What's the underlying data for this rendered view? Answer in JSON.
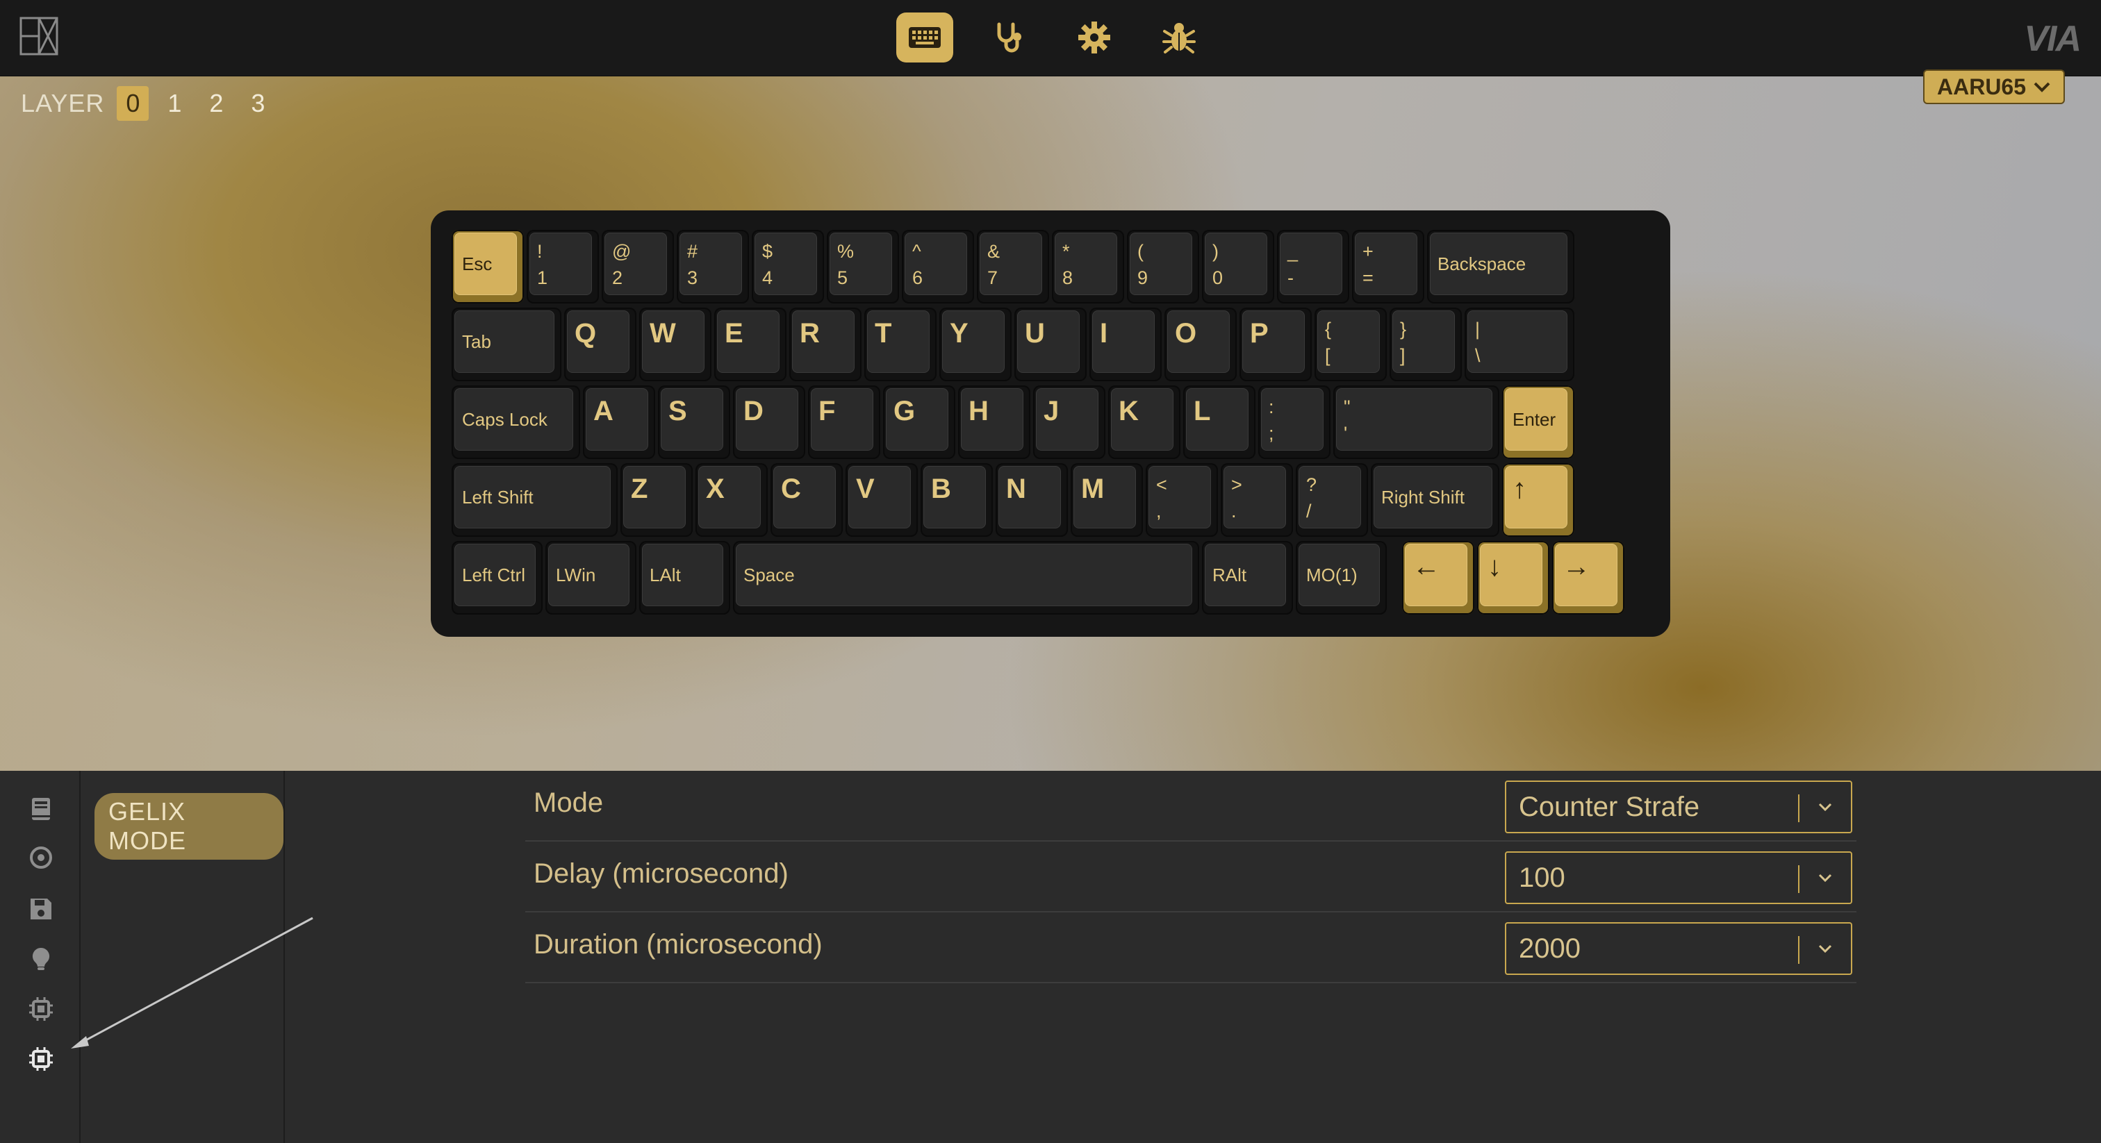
{
  "nav": {
    "items": [
      {
        "name": "keyboard-icon",
        "active": true
      },
      {
        "name": "stethoscope-icon",
        "active": false
      },
      {
        "name": "gear-icon",
        "active": false
      },
      {
        "name": "bug-icon",
        "active": false
      }
    ],
    "brand": "VIA"
  },
  "layers": {
    "label": "LAYER",
    "items": [
      "0",
      "1",
      "2",
      "3"
    ],
    "active": "0"
  },
  "device": {
    "name": "AARU65"
  },
  "keyboard": {
    "rows": [
      [
        {
          "top": "Esc",
          "gold": true
        },
        {
          "top": "!",
          "bottom": "1"
        },
        {
          "top": "@",
          "bottom": "2"
        },
        {
          "top": "#",
          "bottom": "3"
        },
        {
          "top": "$",
          "bottom": "4"
        },
        {
          "top": "%",
          "bottom": "5"
        },
        {
          "top": "^",
          "bottom": "6"
        },
        {
          "top": "&",
          "bottom": "7"
        },
        {
          "top": "*",
          "bottom": "8"
        },
        {
          "top": "(",
          "bottom": "9"
        },
        {
          "top": ")",
          "bottom": "0"
        },
        {
          "top": "_",
          "bottom": "-"
        },
        {
          "top": "+",
          "bottom": "="
        },
        {
          "top": "Backspace"
        }
      ],
      [
        {
          "top": "Tab"
        },
        {
          "top": "Q"
        },
        {
          "top": "W"
        },
        {
          "top": "E"
        },
        {
          "top": "R"
        },
        {
          "top": "T"
        },
        {
          "top": "Y"
        },
        {
          "top": "U"
        },
        {
          "top": "I"
        },
        {
          "top": "O"
        },
        {
          "top": "P"
        },
        {
          "top": "{",
          "bottom": "["
        },
        {
          "top": "}",
          "bottom": "]"
        },
        {
          "top": "|",
          "bottom": "\\"
        }
      ],
      [
        {
          "top": "Caps Lock"
        },
        {
          "top": "A"
        },
        {
          "top": "S"
        },
        {
          "top": "D"
        },
        {
          "top": "F"
        },
        {
          "top": "G"
        },
        {
          "top": "H"
        },
        {
          "top": "J"
        },
        {
          "top": "K"
        },
        {
          "top": "L"
        },
        {
          "top": ":",
          "bottom": ";"
        },
        {
          "top": "\"",
          "bottom": "'"
        },
        {
          "top": "Enter",
          "gold": true
        }
      ],
      [
        {
          "top": "Left Shift"
        },
        {
          "top": "Z"
        },
        {
          "top": "X"
        },
        {
          "top": "C"
        },
        {
          "top": "V"
        },
        {
          "top": "B"
        },
        {
          "top": "N"
        },
        {
          "top": "M"
        },
        {
          "top": "<",
          "bottom": ","
        },
        {
          "top": ">",
          "bottom": "."
        },
        {
          "top": "?",
          "bottom": "/"
        },
        {
          "top": "Right Shift"
        },
        {
          "top": "↑",
          "gold": true
        }
      ],
      [
        {
          "top": "Left Ctrl"
        },
        {
          "top": "LWin"
        },
        {
          "top": "LAlt"
        },
        {
          "top": "Space"
        },
        {
          "top": "RAlt"
        },
        {
          "top": "MO(1)"
        },
        {
          "top": "←",
          "gold": true
        },
        {
          "top": "↓",
          "gold": true
        },
        {
          "top": "→",
          "gold": true
        }
      ]
    ]
  },
  "sidebar": {
    "icons": [
      "book-icon",
      "target-icon",
      "save-icon",
      "lightbulb-icon",
      "chip-icon",
      "chip-icon"
    ]
  },
  "menu": {
    "items": [
      "GELIX MODE"
    ]
  },
  "settings": {
    "rows": [
      {
        "label": "Mode",
        "value": "Counter Strafe"
      },
      {
        "label": "Delay (microsecond)",
        "value": "100"
      },
      {
        "label": "Duration (microsecond)",
        "value": "2000"
      }
    ]
  }
}
